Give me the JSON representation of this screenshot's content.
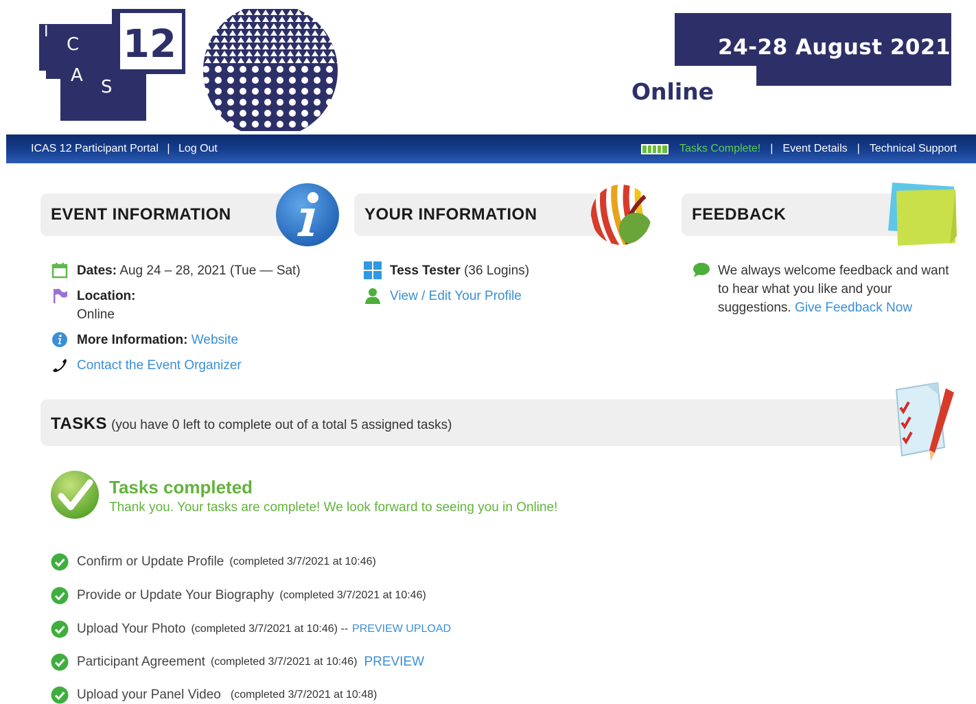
{
  "header": {
    "logo_letters": [
      "I",
      "C",
      "A",
      "S",
      "12"
    ],
    "date_text": "24-28 August 2021",
    "location_text": "Online",
    "brand_color": "#2d3068"
  },
  "nav": {
    "portal_title": "ICAS 12 Participant Portal",
    "separator": "|",
    "logout": "Log Out",
    "tasks_complete": "Tasks Complete!",
    "event_details": "Event Details",
    "technical_support": "Technical Support",
    "colors": {
      "bar": "#163f8f",
      "tasks_complete": "#5ed14d"
    }
  },
  "event_info": {
    "title": "EVENT INFORMATION",
    "dates_label": "Dates:",
    "dates_value": "Aug 24 – 28, 2021 (Tue — Sat)",
    "location_label": "Location:",
    "location_value": "Online",
    "more_info_label": "More Information:",
    "more_info_link": "Website",
    "contact_link": "Contact the Event Organizer"
  },
  "your_info": {
    "title": "YOUR INFORMATION",
    "user_name": "Tess Tester",
    "logins": "(36 Logins)",
    "edit_profile_link": "View / Edit Your Profile"
  },
  "feedback": {
    "title": "FEEDBACK",
    "text": "We always welcome feedback and want to hear what you like and your suggestions.",
    "link": "Give Feedback Now"
  },
  "tasks": {
    "title": "TASKS",
    "subtitle": "(you have 0 left to complete out of a total 5 assigned tasks)",
    "completed_title": "Tasks completed",
    "completed_message": "Thank you. Your tasks are complete! We look forward to seeing you in Online!",
    "items": [
      {
        "name": "Confirm or Update Profile",
        "meta": "(completed 3/7/2021 at 10:46)",
        "link": ""
      },
      {
        "name": "Provide or Update Your Biography",
        "meta": "(completed 3/7/2021 at 10:46)",
        "link": ""
      },
      {
        "name": "Upload Your Photo",
        "meta": "(completed 3/7/2021 at 10:46) --",
        "link": "PREVIEW UPLOAD"
      },
      {
        "name": "Participant Agreement",
        "meta": "(completed 3/7/2021 at 10:46)",
        "link": "PREVIEW"
      },
      {
        "name": "Upload your Panel Video",
        "meta": "(completed 3/7/2021 at 10:48)",
        "link": ""
      }
    ],
    "colors": {
      "check": "#3fae3f",
      "completed_text": "#62b33c"
    }
  }
}
